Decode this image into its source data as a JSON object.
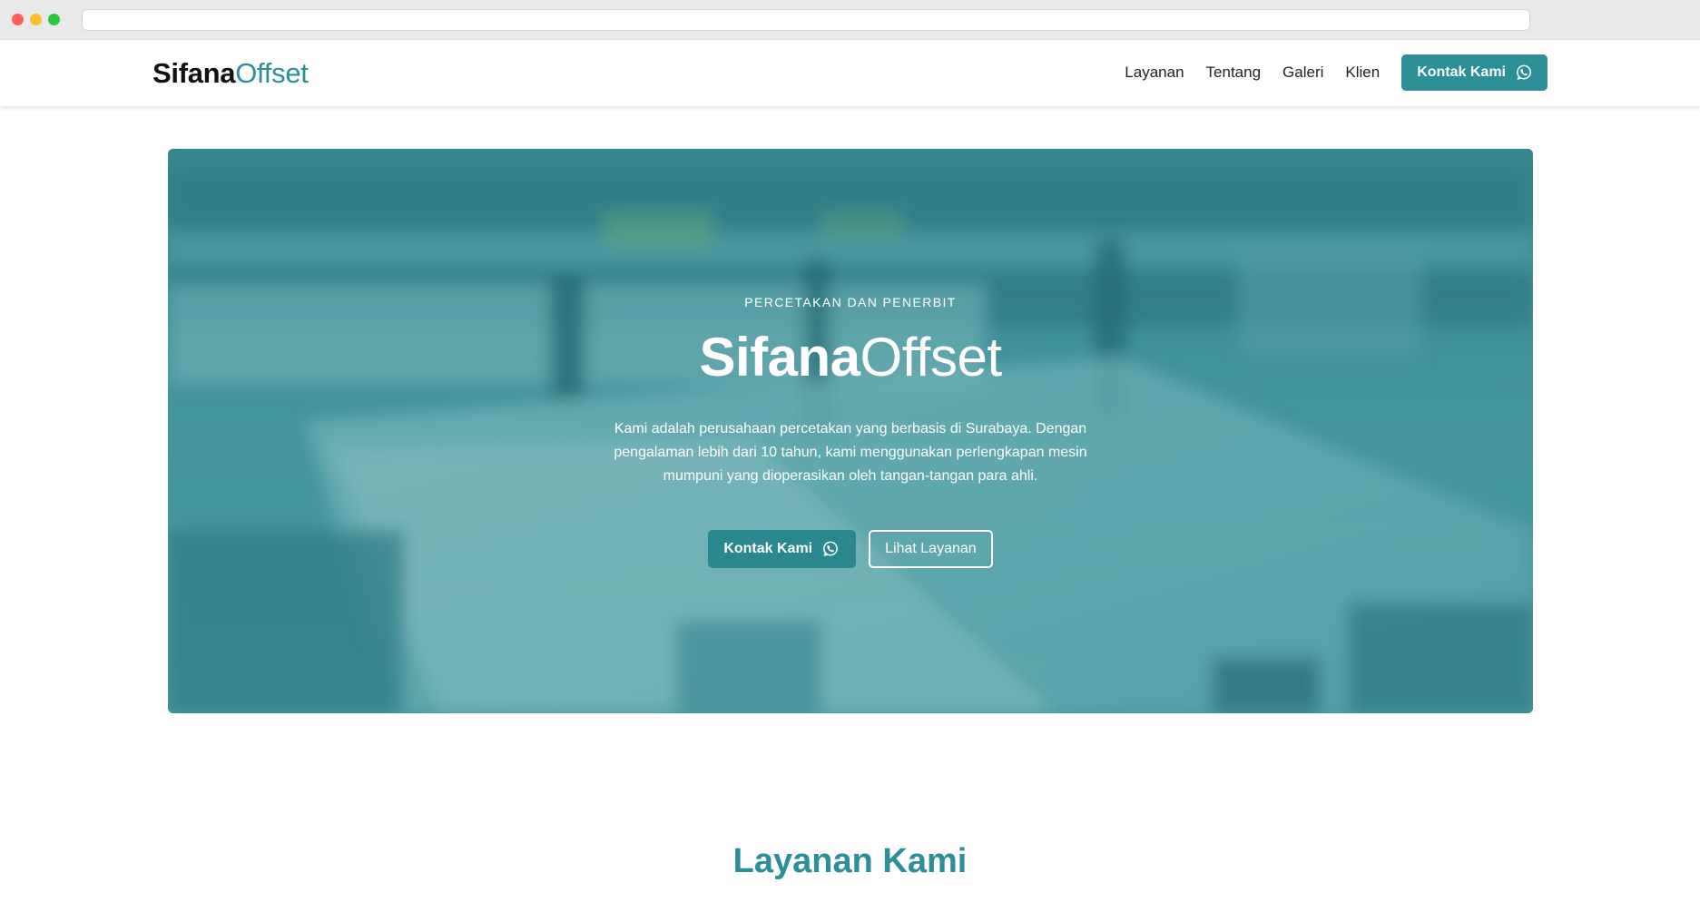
{
  "colors": {
    "brand": "#2c8e97",
    "hero_overlay": "#3f8f99",
    "text_dark": "#222222"
  },
  "brand": {
    "name_bold": "Sifana",
    "name_light": "Offset"
  },
  "nav": {
    "items": [
      "Layanan",
      "Tentang",
      "Galeri",
      "Klien"
    ],
    "cta_label": "Kontak Kami",
    "cta_icon": "whatsapp-icon"
  },
  "hero": {
    "eyebrow": "PERCETAKAN DAN PENERBIT",
    "title_bold": "Sifana",
    "title_light": "Offset",
    "description": "Kami adalah perusahaan percetakan yang berbasis di Surabaya. Dengan pengalaman lebih dari 10 tahun, kami menggunakan perlengkapan mesin mumpuni yang dioperasikan oleh tangan-tangan para ahli.",
    "primary_label": "Kontak Kami",
    "secondary_label": "Lihat Layanan",
    "background_image": "printing-press-photo"
  },
  "sections": {
    "services_title": "Layanan Kami"
  }
}
